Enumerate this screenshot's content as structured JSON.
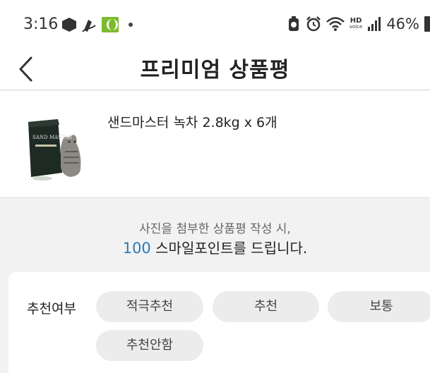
{
  "status_bar": {
    "time": "3:16",
    "battery_percent": "46%",
    "hd_line1": "HD",
    "hd_line2": "voice"
  },
  "header": {
    "title": "프리미엄 상품평"
  },
  "product": {
    "name": "샌드마스터 녹차 2.8kg x 6개",
    "image_text": "SAND MASTER"
  },
  "banner": {
    "line1": "사진을 첨부한 상품평 작성 시,",
    "points": "100",
    "line2_suffix": " 스마일포인트를 드립니다."
  },
  "recommendation": {
    "label": "추천여부",
    "options": [
      "적극추천",
      "추천",
      "보통",
      "추천안함"
    ]
  },
  "colors": {
    "accent_points": "#2a7ab8",
    "chip_bg": "#ececec"
  }
}
